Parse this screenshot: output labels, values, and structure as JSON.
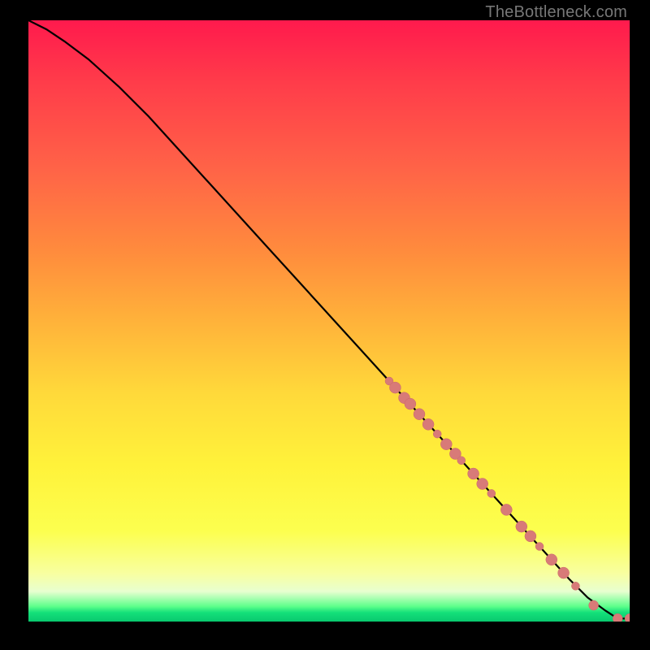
{
  "watermark": "TheBottleneck.com",
  "colors": {
    "curve": "#000000",
    "marker_fill": "#d87a78",
    "marker_stroke": "#c96a68",
    "gradient_top": "#ff1a4d",
    "gradient_green": "#14e07a"
  },
  "chart_data": {
    "type": "line",
    "title": "",
    "xlabel": "",
    "ylabel": "",
    "xlim": [
      0,
      100
    ],
    "ylim": [
      0,
      100
    ],
    "grid": false,
    "series": [
      {
        "name": "bottleneck-curve",
        "x": [
          0,
          3,
          6,
          10,
          15,
          20,
          25,
          30,
          35,
          40,
          45,
          50,
          55,
          60,
          65,
          70,
          75,
          80,
          85,
          90,
          93,
          96,
          98,
          100
        ],
        "y": [
          100,
          98.5,
          96.5,
          93.5,
          89,
          84,
          78.5,
          73,
          67.5,
          62,
          56.5,
          51,
          45.5,
          40,
          34.5,
          29,
          23.5,
          18,
          12.5,
          7,
          4,
          1.8,
          0.5,
          0.5
        ]
      }
    ],
    "markers": [
      {
        "x": 60,
        "y": 40.0,
        "r": 5
      },
      {
        "x": 61,
        "y": 38.9,
        "r": 7
      },
      {
        "x": 62.5,
        "y": 37.2,
        "r": 7
      },
      {
        "x": 63.5,
        "y": 36.2,
        "r": 7
      },
      {
        "x": 65,
        "y": 34.5,
        "r": 7
      },
      {
        "x": 66.5,
        "y": 32.8,
        "r": 7
      },
      {
        "x": 68,
        "y": 31.2,
        "r": 5
      },
      {
        "x": 69.5,
        "y": 29.5,
        "r": 7
      },
      {
        "x": 71,
        "y": 27.9,
        "r": 7
      },
      {
        "x": 72,
        "y": 26.8,
        "r": 5
      },
      {
        "x": 74,
        "y": 24.6,
        "r": 7
      },
      {
        "x": 75.5,
        "y": 22.9,
        "r": 7
      },
      {
        "x": 77,
        "y": 21.3,
        "r": 5
      },
      {
        "x": 79.5,
        "y": 18.6,
        "r": 7
      },
      {
        "x": 82,
        "y": 15.8,
        "r": 7
      },
      {
        "x": 83.5,
        "y": 14.2,
        "r": 7
      },
      {
        "x": 85,
        "y": 12.5,
        "r": 5
      },
      {
        "x": 87,
        "y": 10.3,
        "r": 7
      },
      {
        "x": 89,
        "y": 8.1,
        "r": 7
      },
      {
        "x": 91,
        "y": 5.9,
        "r": 5
      },
      {
        "x": 94,
        "y": 2.7,
        "r": 6
      },
      {
        "x": 98,
        "y": 0.5,
        "r": 6
      },
      {
        "x": 100,
        "y": 0.5,
        "r": 6
      }
    ]
  }
}
